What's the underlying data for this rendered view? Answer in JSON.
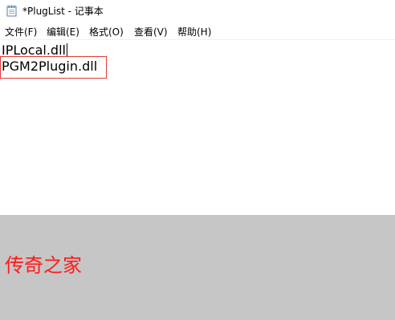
{
  "window": {
    "title": "*PlugList - 记事本",
    "icon": "notepad-icon"
  },
  "menu": {
    "items": [
      {
        "label": "文件(F)"
      },
      {
        "label": "编辑(E)"
      },
      {
        "label": "格式(O)"
      },
      {
        "label": "查看(V)"
      },
      {
        "label": "帮助(H)"
      }
    ]
  },
  "editor": {
    "lines": [
      "IPLocal.dll",
      "PGM2Plugin.dll"
    ]
  },
  "watermark": {
    "text": "传奇之家"
  },
  "colors": {
    "highlight_border": "#e53935",
    "watermark_band": "#c6c6c6",
    "watermark_text": "#ff1a1a"
  }
}
